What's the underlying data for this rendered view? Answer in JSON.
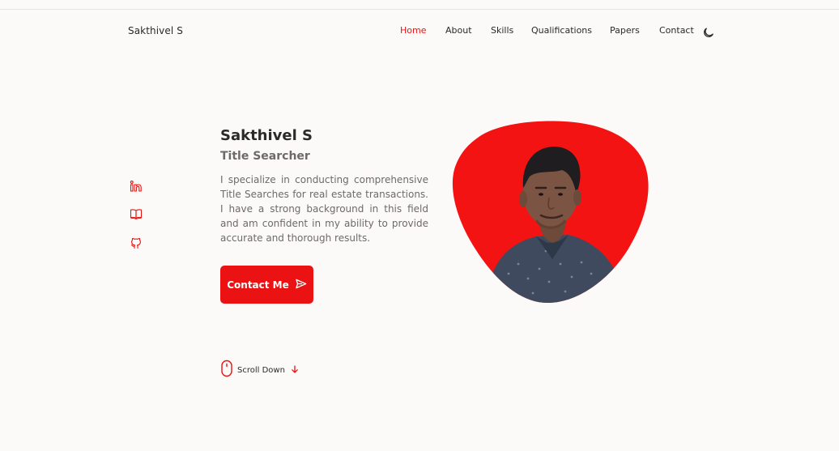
{
  "header": {
    "brand": "Sakthivel S",
    "nav": [
      {
        "label": "Home",
        "active": true
      },
      {
        "label": "About",
        "active": false
      },
      {
        "label": "Skills",
        "active": false
      },
      {
        "label": "Qualifications",
        "active": false
      },
      {
        "label": "Papers",
        "active": false
      },
      {
        "label": "Contact",
        "active": false
      }
    ],
    "theme_icon": "moon-icon"
  },
  "socials": [
    {
      "icon": "linkedin-icon"
    },
    {
      "icon": "book-icon"
    },
    {
      "icon": "github-icon"
    }
  ],
  "hero": {
    "name": "Sakthivel S",
    "title": "Title Searcher",
    "description": "I specialize in conducting comprehensive Title Searches for real estate transactions. I have a strong background in this field and am confident in my ability to provide accurate and thorough results.",
    "button_label": "Contact Me",
    "button_icon": "send-icon",
    "photo_icon": "profile-photo"
  },
  "scroll": {
    "label": "Scroll Down",
    "mouse_icon": "mouse-icon",
    "arrow_icon": "arrow-down-icon"
  },
  "colors": {
    "accent": "#ea1212",
    "background": "#fcfaf8",
    "text": "#2b2929",
    "muted": "#6d6a68"
  }
}
